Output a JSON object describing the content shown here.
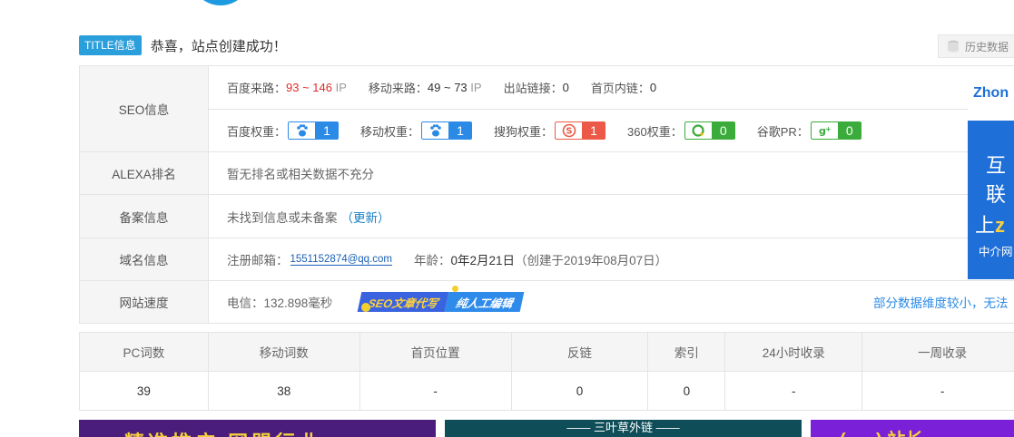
{
  "title": {
    "tag": "TITLE信息",
    "text": "恭喜，站点创建成功！"
  },
  "history_button": "历史数据",
  "seo": {
    "label": "SEO信息",
    "baidu_traffic_label": "百度来路：",
    "baidu_traffic_value": "93 ~ 146",
    "baidu_traffic_unit": "IP",
    "mobile_traffic_label": "移动来路：",
    "mobile_traffic_value": "49 ~ 73",
    "mobile_traffic_unit": "IP",
    "outlinks_label": "出站链接：",
    "outlinks_value": "0",
    "homepage_links_label": "首页内链：",
    "homepage_links_value": "0",
    "baidu_weight_label": "百度权重：",
    "baidu_weight_value": "1",
    "mobile_weight_label": "移动权重：",
    "mobile_weight_value": "1",
    "sogou_weight_label": "搜狗权重：",
    "sogou_weight_value": "1",
    "weight360_label": "360权重：",
    "weight360_value": "0",
    "google_pr_label": "谷歌PR：",
    "google_pr_value": "0"
  },
  "alexa": {
    "label": "ALEXA排名",
    "value": "暂无排名或相关数据不充分"
  },
  "beian": {
    "label": "备案信息",
    "value": "未找到信息或未备案",
    "update_open": "（",
    "update_link": "更新",
    "update_close": "）"
  },
  "domain": {
    "label": "域名信息",
    "email_label": "注册邮箱：",
    "email_value": "1551152874@qq.com",
    "age_label": "年龄：",
    "age_value": "0年2月21日",
    "created_text": "（创建于2019年08月07日）"
  },
  "speed": {
    "label": "网站速度",
    "value": "电信：132.898毫秒",
    "banner_left": "SEO文章代写",
    "banner_right": "纯人工编辑",
    "notice": "部分数据维度较小，无法"
  },
  "ad_right": {
    "brand": "Zhon",
    "line1": "互联",
    "line2_prefix": "上",
    "line2_highlight": "z",
    "line3": "中介网"
  },
  "stats": {
    "headers": [
      "PC词数",
      "移动词数",
      "首页位置",
      "反链",
      "索引",
      "24小时收录",
      "一周收录"
    ],
    "values": [
      "39",
      "38",
      "-",
      "0",
      "0",
      "-",
      "-"
    ]
  },
  "banners": {
    "b1": "精准推广 网盟行业",
    "b2": "—— 三叶草外链 ——",
    "b3": "(___) 站长"
  },
  "colors": {
    "accent": "#2b9fdb",
    "red": "#e02c2c",
    "green": "#3bab3b",
    "blue": "#2b8ae6"
  }
}
